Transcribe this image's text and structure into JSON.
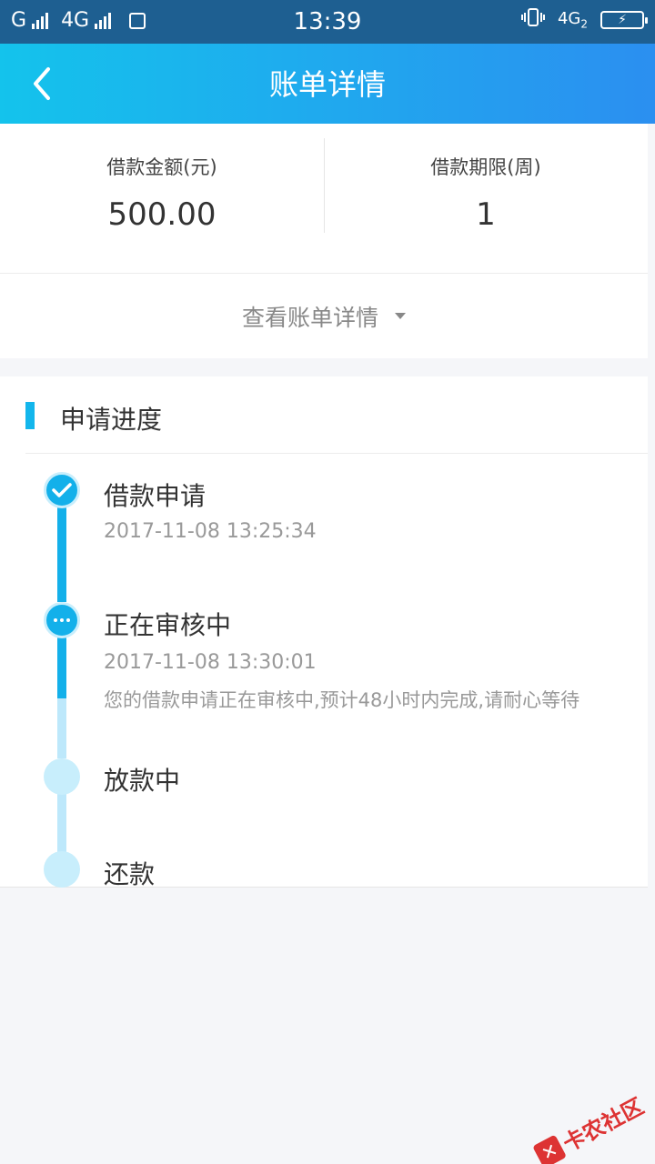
{
  "status_bar": {
    "sim1": "G",
    "sim2": "4G",
    "time": "13:39",
    "network": "4G",
    "network_sub": "2",
    "battery": "⚡"
  },
  "header": {
    "title": "账单详情",
    "back_icon": "chevron-left-icon"
  },
  "summary": {
    "amount_label": "借款金额(元)",
    "amount_value": "500.00",
    "term_label": "借款期限(周)",
    "term_value": "1"
  },
  "details_toggle": {
    "label": "查看账单详情",
    "icon": "caret-down-icon"
  },
  "progress": {
    "section_title": "申请进度",
    "steps": [
      {
        "title": "借款申请",
        "time": "2017-11-08 13:25:34",
        "status": "done",
        "icon": "check-icon"
      },
      {
        "title": "正在审核中",
        "time": "2017-11-08 13:30:01",
        "note": "您的借款申请正在审核中,预计48小时内完成,请耐心等待",
        "status": "in-progress",
        "icon": "more-dots-icon"
      },
      {
        "title": "放款中",
        "status": "pending"
      },
      {
        "title": "还款",
        "status": "pending"
      }
    ]
  },
  "watermark": {
    "text": "卡农社区"
  },
  "colors": {
    "accent": "#13b0ea",
    "accent_light": "#c8eefc",
    "header_gradient_start": "#14c3ec",
    "header_gradient_end": "#2b8ff0",
    "status_bar": "#1e5f91"
  }
}
